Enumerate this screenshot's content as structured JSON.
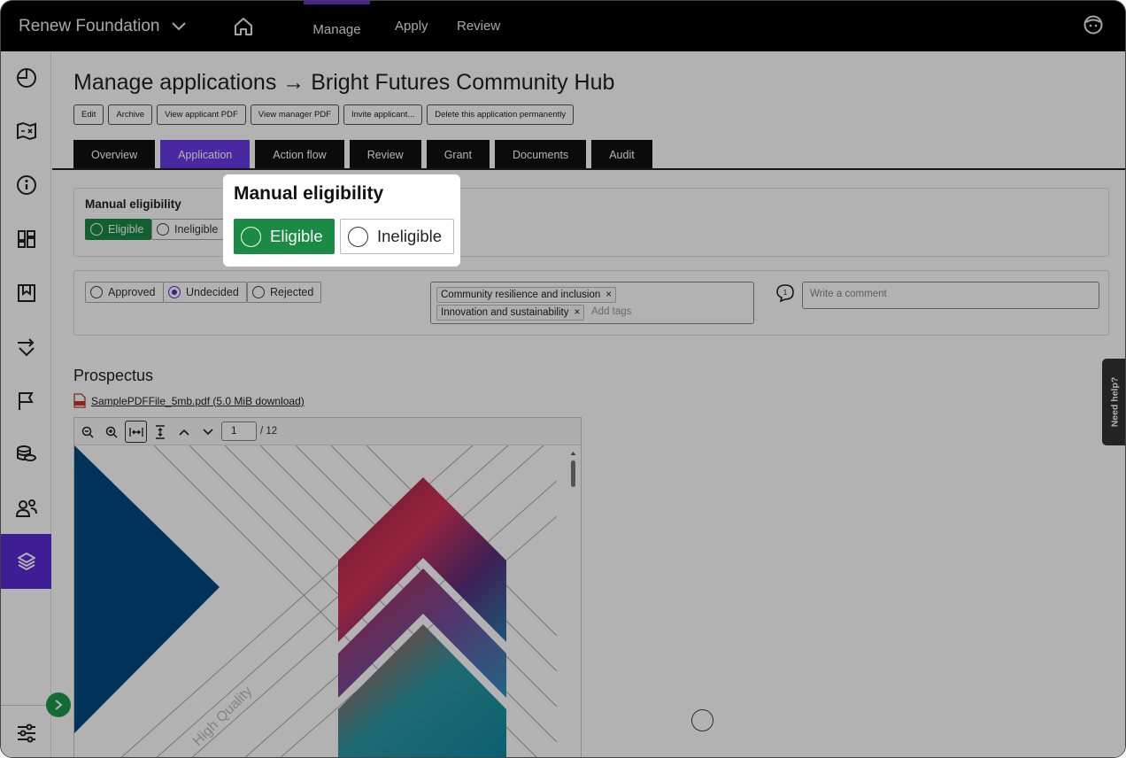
{
  "topbar": {
    "org_name": "Renew Foundation",
    "nav": [
      "Manage",
      "Apply",
      "Review"
    ],
    "active_nav": "Manage"
  },
  "sidebar": {
    "items": [
      "dashboard-icon",
      "map-icon",
      "info-icon",
      "grid-icon",
      "bookmark-icon",
      "workflow-icon",
      "flag-icon",
      "coins-icon",
      "users-icon",
      "layers-icon"
    ],
    "active": "layers-icon",
    "bottom": "sliders-icon"
  },
  "page": {
    "title": "Manage applications → Bright Futures Community Hub",
    "actions": [
      "Edit",
      "Archive",
      "View applicant PDF",
      "View manager PDF",
      "Invite applicant...",
      "Delete this application permanently"
    ],
    "tabs": [
      "Overview",
      "Application",
      "Action flow",
      "Review",
      "Grant",
      "Documents",
      "Audit"
    ],
    "active_tab": "Application"
  },
  "eligibility": {
    "label": "Manual eligibility",
    "options": [
      "Eligible",
      "Ineligible"
    ],
    "selected": "Eligible"
  },
  "status": {
    "options": [
      "Approved",
      "Undecided",
      "Rejected"
    ],
    "selected": "Undecided"
  },
  "tags": {
    "items": [
      "Community resilience and inclusion",
      "Innovation and sustainability"
    ],
    "remove_glyph": "×",
    "placeholder": "Add tags"
  },
  "comment": {
    "count": "1",
    "placeholder": "Write a comment"
  },
  "prospectus": {
    "heading": "Prospectus",
    "file_link": "SamplePDFFile_5mb.pdf (5.0 MiB download)",
    "page_current": "1",
    "page_total": "/ 12",
    "watermark": "High Quality"
  },
  "help": {
    "label": "Need help?"
  },
  "colors": {
    "topbar": "#000000",
    "accent": "#6a3ae8",
    "eligible_green": "#1a8a44",
    "pdf_blue": "#004a80"
  }
}
